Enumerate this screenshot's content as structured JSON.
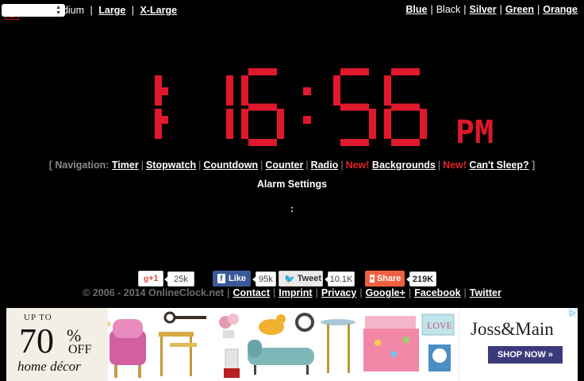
{
  "size_menu": {
    "select_value": "",
    "visible_prefix": "edium",
    "large": "Large",
    "xlarge": "X-Large",
    "separator": "|"
  },
  "colors_menu": {
    "blue": "Blue",
    "black": "Black",
    "silver": "Silver",
    "green": "Green",
    "orange": "Orange"
  },
  "clock": {
    "hour": "1",
    "minutes": "16",
    "seconds": "56",
    "ampm": "PM",
    "digit_color": "#e0182c"
  },
  "nav": {
    "open_bracket": "[",
    "prefix": "Navigation:",
    "items": [
      "Timer",
      "Stopwatch",
      "Countdown",
      "Counter",
      "Radio"
    ],
    "new_label": "New!",
    "backgrounds": "Backgrounds",
    "cant_sleep": "Can't Sleep?",
    "close_bracket": "]"
  },
  "alarm_settings": "Alarm Settings",
  "colon_text": ":",
  "social": {
    "gplus": {
      "label": "+1",
      "count": "25k",
      "color": "#dd4b39"
    },
    "facebook": {
      "label": "Like",
      "count": "95k",
      "color": "#3b5998"
    },
    "twitter": {
      "label": "Tweet",
      "count": "10.1K",
      "color": "#eaeaea"
    },
    "share": {
      "label": "Share",
      "count": "219K",
      "color": "#f05f40"
    }
  },
  "footer": {
    "copyright": "© 2006 - 2014 OnlineClock.net",
    "links": [
      "Contact",
      "Imprint",
      "Privacy",
      "Google+",
      "Facebook",
      "Twitter"
    ]
  },
  "ad": {
    "up_to": "UP TO",
    "percent_number": "70",
    "percent_sign": "%",
    "off": "OFF",
    "tagline": "home décor",
    "brand": "Joss&Main",
    "cta": "SHOP NOW »",
    "sign_text": "LOVE"
  }
}
